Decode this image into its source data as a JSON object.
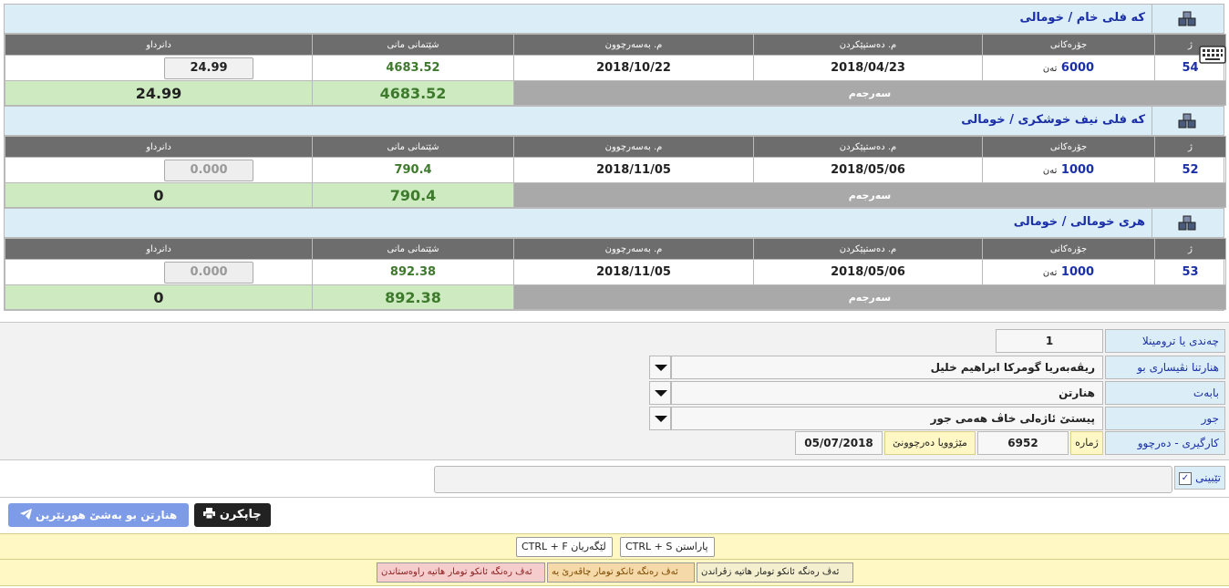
{
  "headers": {
    "num": "ژ",
    "type": "جۆرەکانی",
    "start_date": "م. دەستپێکردن",
    "end_date": "م. بەسەرچوون",
    "national_value": "شێتمانی مانی",
    "amount": "دانرداو"
  },
  "sections": [
    {
      "title": "كه فلی خام / خومالی",
      "row": {
        "num": "54",
        "qty": "6000",
        "unit": "تەن",
        "start": "2018/04/23",
        "end": "2018/10/22",
        "value": "4683.52",
        "amount": "24.99"
      },
      "sum": {
        "label": "سەرجەم",
        "value": "4683.52",
        "amount": "24.99"
      },
      "amount_disabled": false
    },
    {
      "title": "كه فلی نیف خوشكری / خومالی",
      "row": {
        "num": "52",
        "qty": "1000",
        "unit": "تەن",
        "start": "2018/05/06",
        "end": "2018/11/05",
        "value": "790.4",
        "amount": "0.000"
      },
      "sum": {
        "label": "سەرجەم",
        "value": "790.4",
        "amount": "0"
      },
      "amount_disabled": true
    },
    {
      "title": "هری خومالی / خومالی",
      "row": {
        "num": "53",
        "qty": "1000",
        "unit": "تەن",
        "start": "2018/05/06",
        "end": "2018/11/05",
        "value": "892.38",
        "amount": "0.000"
      },
      "sum": {
        "label": "سەرجەم",
        "value": "892.38",
        "amount": "0"
      },
      "amount_disabled": true
    }
  ],
  "form": {
    "copies_label": "چەندی یا ترومینلا",
    "copies_value": "1",
    "recipient_label": "هنارتنا نڤیساری بو",
    "recipient_value": "ريڤەبەریا گومركا ابراهیم خلیل",
    "topic_label": "بابەت",
    "topic_value": "هنارتن",
    "kind_label": "جور",
    "kind_value": "پیستێ ئاژەلی خاڤ هەمی جور",
    "outgoing_label": "كارگیری - دەرچوو",
    "number_label": "ژمارە",
    "number_value": "6952",
    "date_label": "مێژوویا دەرچوونێ",
    "date_value": "05/07/2018"
  },
  "notes": {
    "label": "تێبینی",
    "check": "✓"
  },
  "buttons": {
    "print": "چاپكرن",
    "send": "هنارتن بو بەشێ هورنێرین"
  },
  "shortcuts": {
    "save": "CTRL + S پاراستن",
    "find": "CTRL + F لێگەریان"
  },
  "legends": {
    "l1": "ئەڤ رەنگە ئانكو تومار هاتیە زڤراندن",
    "l2": "ئەڤ رەنگە ئانكو تومار چاڤەرێ یە",
    "l3": "ئەڤ رەنگە ئانكو تومار هاتیە راوەستاندن"
  },
  "colors": {
    "header_bg": "#6d6d6d",
    "title": "#1b2fa8",
    "sum_green": "#cdeac0",
    "info": "#dbeef8",
    "note": "#fff8c4"
  }
}
